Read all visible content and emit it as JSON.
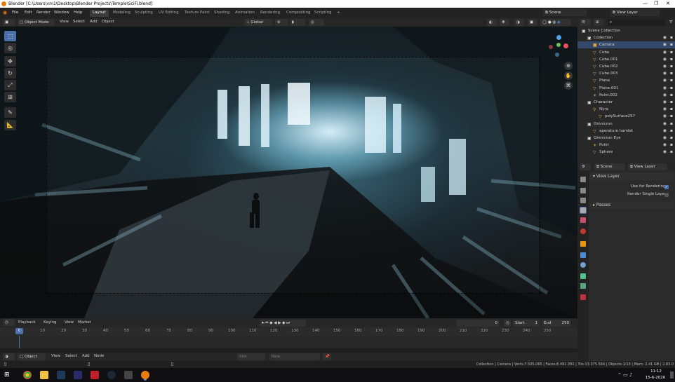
{
  "window": {
    "title": "Blender [C:\\Users\\vm1\\Desktop\\Blender Projects\\Temple\\SciFi.blend]",
    "controls": [
      "—",
      "❐",
      "✕"
    ]
  },
  "menubar": {
    "items": [
      "File",
      "Edit",
      "Render",
      "Window",
      "Help"
    ],
    "workspaces": [
      "Layout",
      "Modeling",
      "Sculpting",
      "UV Editing",
      "Texture Paint",
      "Shading",
      "Animation",
      "Rendering",
      "Compositing",
      "Scripting"
    ],
    "active_workspace": "Layout",
    "add_workspace": "+",
    "scene": "Scene",
    "view_layer": "View Layer"
  },
  "viewport_header": {
    "mode": "Object Mode",
    "menus": [
      "View",
      "Select",
      "Add",
      "Object"
    ],
    "transform_orientation": "Global"
  },
  "toolbar": {
    "tools": [
      "select-box",
      "cursor",
      "move",
      "rotate",
      "scale",
      "transform",
      "annotate",
      "measure"
    ]
  },
  "timeline": {
    "menus": [
      "Playback",
      "Keying",
      "View",
      "Marker"
    ],
    "current_frame": "0",
    "start_label": "Start",
    "start": "1",
    "end_label": "End",
    "end": "250",
    "ticks": [
      "0",
      "10",
      "20",
      "30",
      "40",
      "50",
      "60",
      "70",
      "80",
      "90",
      "100",
      "110",
      "120",
      "130",
      "140",
      "150",
      "160",
      "170",
      "180",
      "190",
      "200",
      "210",
      "220",
      "230",
      "240",
      "250"
    ],
    "playhead": "0"
  },
  "bottom_editor": {
    "mode": "Object",
    "menus": [
      "View",
      "Select",
      "Add",
      "Node"
    ],
    "slot": "Slot",
    "new": "New"
  },
  "statusbar": {
    "text": "Collection | Camera | Verts:7.505.065 | Faces:8.491.391 | Tris:13.375.564 | Objects:1/13 | Mem: 2.41 GB | 2.83.0"
  },
  "outliner": {
    "search_placeholder": "",
    "rows": [
      {
        "label": "Scene Collection",
        "indent": 0,
        "icon": "collection"
      },
      {
        "label": "Collection",
        "indent": 1,
        "icon": "collection"
      },
      {
        "label": "Camera",
        "indent": 2,
        "icon": "camera",
        "selected": true
      },
      {
        "label": "Cube",
        "indent": 2,
        "icon": "mesh"
      },
      {
        "label": "Cube.001",
        "indent": 2,
        "icon": "mesh"
      },
      {
        "label": "Cube.002",
        "indent": 2,
        "icon": "mesh"
      },
      {
        "label": "Cube.003",
        "indent": 2,
        "icon": "mesh"
      },
      {
        "label": "Plane",
        "indent": 2,
        "icon": "mesh"
      },
      {
        "label": "Plane.001",
        "indent": 2,
        "icon": "mesh"
      },
      {
        "label": "Point.002",
        "indent": 2,
        "icon": "light"
      },
      {
        "label": "Character",
        "indent": 1,
        "icon": "collection"
      },
      {
        "label": "Nyra",
        "indent": 2,
        "icon": "armature"
      },
      {
        "label": "polySurface257",
        "indent": 3,
        "icon": "mesh"
      },
      {
        "label": "Omnicron",
        "indent": 1,
        "icon": "collection"
      },
      {
        "label": "aperature hamlet",
        "indent": 2,
        "icon": "mesh"
      },
      {
        "label": "Omnicron Eye",
        "indent": 1,
        "icon": "collection"
      },
      {
        "label": "Point",
        "indent": 2,
        "icon": "light"
      },
      {
        "label": "Sphere",
        "indent": 2,
        "icon": "mesh"
      }
    ]
  },
  "properties": {
    "scene": "Scene",
    "view_layer": "View Layer",
    "panel_title": "View Layer",
    "use_for_rendering": "Use for Rendering",
    "render_single_layer": "Render Single Layer",
    "passes": "Passes"
  },
  "colors": {
    "accent": "#4c6fa8",
    "selection": "#33486a",
    "blender_orange": "#e87d0d",
    "mesh_green": "#4fc48a",
    "camera_orange": "#e0a040"
  },
  "taskbar": {
    "time": "11:12",
    "date": "15-6-2020"
  }
}
